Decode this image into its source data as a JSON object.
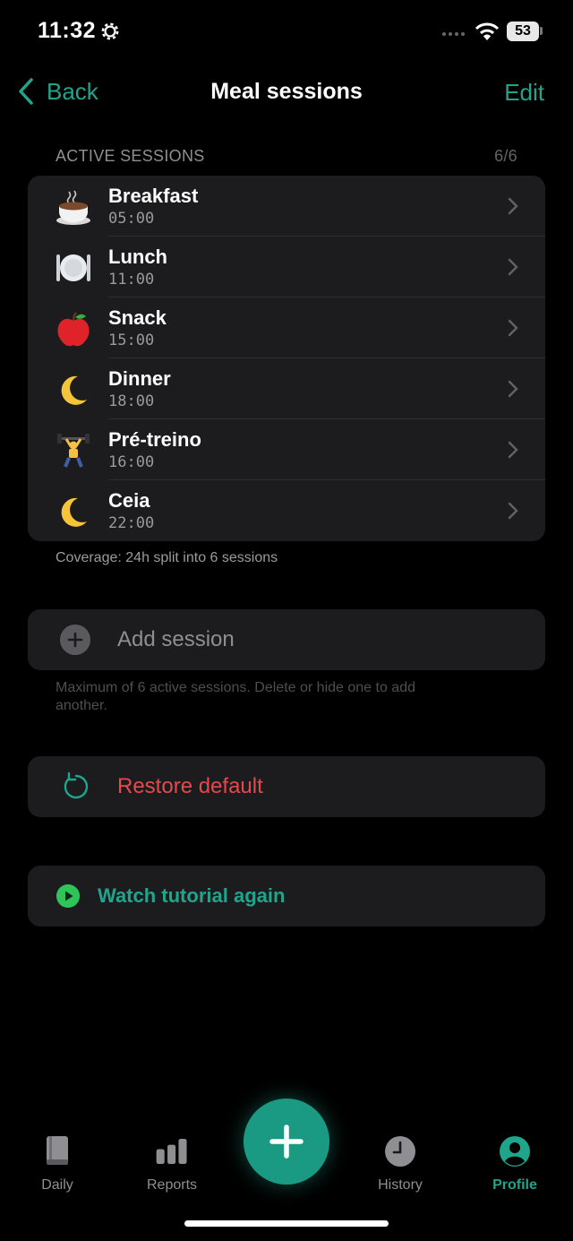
{
  "status_bar": {
    "time": "11:32",
    "battery": "53"
  },
  "nav": {
    "back_label": "Back",
    "title": "Meal sessions",
    "edit_label": "Edit"
  },
  "section": {
    "header": "ACTIVE SESSIONS",
    "count": "6/6"
  },
  "sessions": [
    {
      "name": "Breakfast",
      "time": "05:00",
      "icon": "coffee-icon"
    },
    {
      "name": "Lunch",
      "time": "11:00",
      "icon": "plate-cutlery-icon"
    },
    {
      "name": "Snack",
      "time": "15:00",
      "icon": "apple-icon"
    },
    {
      "name": "Dinner",
      "time": "18:00",
      "icon": "crescent-moon-icon"
    },
    {
      "name": "Pré-treino",
      "time": "16:00",
      "icon": "weightlifter-icon"
    },
    {
      "name": "Ceia",
      "time": "22:00",
      "icon": "crescent-moon-icon"
    }
  ],
  "coverage": "Coverage: 24h split into 6 sessions",
  "add_session": {
    "label": "Add session",
    "note": "Maximum of 6 active sessions. Delete or hide one to add another."
  },
  "restore": {
    "label": "Restore default"
  },
  "tutorial": {
    "label": "Watch tutorial again"
  },
  "tabs": [
    {
      "label": "Daily",
      "icon": "book-icon"
    },
    {
      "label": "Reports",
      "icon": "bar-chart-icon"
    },
    {
      "label": "History",
      "icon": "clock-icon"
    },
    {
      "label": "Profile",
      "icon": "person-icon",
      "active": true
    }
  ],
  "colors": {
    "accent": "#1fa58c",
    "danger": "#e5484d",
    "card": "#1c1c1e",
    "background": "#000000"
  }
}
